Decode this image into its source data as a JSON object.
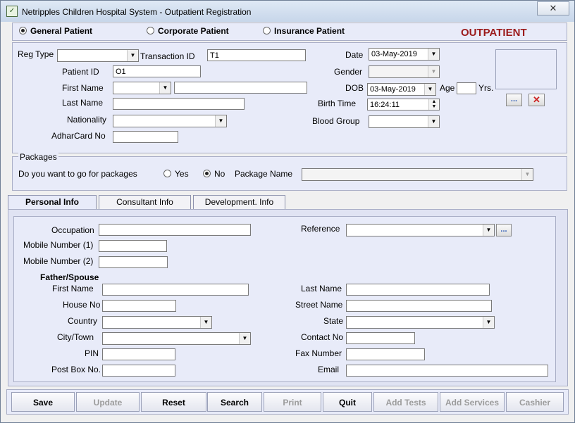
{
  "window": {
    "title": "Netripples Children Hospital  System - Outpatient Registration",
    "close_glyph": "✕"
  },
  "patient_type": {
    "options": [
      "General Patient",
      "Corporate Patient",
      "Insurance Patient"
    ],
    "selected": "General Patient",
    "banner": "OUTPATIENT"
  },
  "registration": {
    "reg_type_label": "Reg Type",
    "reg_type_value": "",
    "transaction_id_label": "Transaction ID",
    "transaction_id_value": "T1",
    "patient_id_label": "Patient ID",
    "patient_id_value": "O1",
    "first_name_label": "First Name",
    "last_name_label": "Last Name",
    "nationality_label": "Nationality",
    "adhar_label": "AdharCard No",
    "date_label": "Date",
    "date_value": "03-May-2019",
    "gender_label": "Gender",
    "dob_label": "DOB",
    "dob_value": "03-May-2019",
    "age_label": "Age",
    "age_unit": "Yrs.",
    "birth_time_label": "Birth Time",
    "birth_time_value": "16:24:11",
    "blood_group_label": "Blood Group",
    "photo_browse_label": "...",
    "photo_clear_glyph": "✕"
  },
  "packages": {
    "section_title": "Packages",
    "question": "Do you want to go for packages",
    "yes_label": "Yes",
    "no_label": "No",
    "selected": "No",
    "package_name_label": "Package Name"
  },
  "tabs": [
    "Personal Info",
    "Consultant Info",
    "Development. Info"
  ],
  "personal": {
    "occupation_label": "Occupation",
    "mobile1_label": "Mobile Number (1)",
    "mobile2_label": "Mobile Number (2)",
    "reference_label": "Reference",
    "reference_browse": "...",
    "father_header": "Father/Spouse",
    "first_name_label": "First Name",
    "last_name_label": "Last Name",
    "house_no_label": "House No",
    "street_label": "Street Name",
    "country_label": "Country",
    "state_label": "State",
    "city_label": "City/Town",
    "contact_label": "Contact No",
    "pin_label": "PIN",
    "fax_label": "Fax Number",
    "postbox_label": "Post Box No.",
    "email_label": "Email"
  },
  "actions": [
    "Save",
    "Update",
    "Reset",
    "Search",
    "Print",
    "Quit",
    "Add Tests",
    "Add Services",
    "Cashier"
  ],
  "disabled_actions": [
    "Update",
    "Print",
    "Add Tests",
    "Add Services",
    "Cashier"
  ],
  "colors": {
    "banner": "#9b1a1a",
    "panel": "#e8ebf9",
    "clear_button": "#cc2222",
    "browse_text": "#2050b0"
  }
}
